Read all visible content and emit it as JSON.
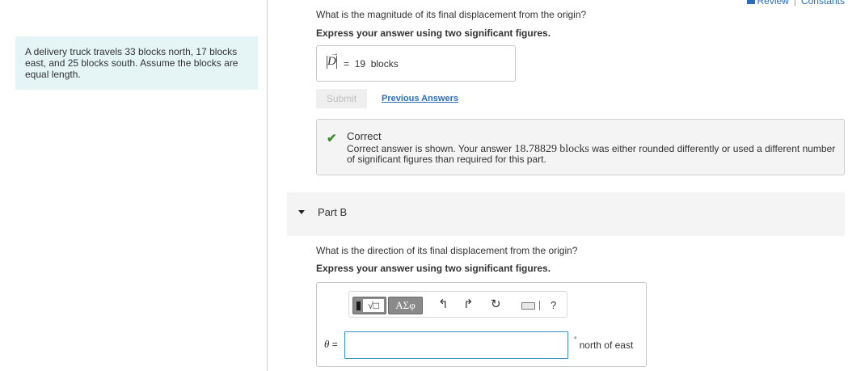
{
  "top_links": {
    "review": "Review",
    "constants": "Constants"
  },
  "problem": {
    "text": "A delivery truck travels 33 blocks north, 17 blocks east, and 25 blocks south. Assume the blocks are equal length."
  },
  "part_a": {
    "question": "What is the magnitude of its final displacement from the origin?",
    "instruction": "Express your answer using two significant figures.",
    "variable": "D",
    "equals": "=",
    "answer_value": "19",
    "answer_unit": "blocks",
    "submit_label": "Submit",
    "previous_answers_label": "Previous Answers",
    "feedback": {
      "title": "Correct",
      "body_prefix": "Correct answer is shown. Your answer",
      "body_value": "18.78829",
      "body_unit": "blocks",
      "body_suffix": "was either rounded differently or used a different number of significant figures than required for this part."
    }
  },
  "part_b": {
    "title": "Part B",
    "question": "What is the direction of its final displacement from the origin?",
    "instruction": "Express your answer using two significant figures.",
    "toolbar": {
      "templates_label": "√□",
      "symbols_label": "ΑΣφ",
      "help_label": "?"
    },
    "variable": "θ",
    "equals": "=",
    "input_value": "",
    "unit_degree": "°",
    "unit_text": "north of east"
  },
  "colors": {
    "accent": "#2a6ebb",
    "problem_bg": "#e5f5f6",
    "success": "#3a8f2a",
    "input_border": "#3a8fc7"
  }
}
